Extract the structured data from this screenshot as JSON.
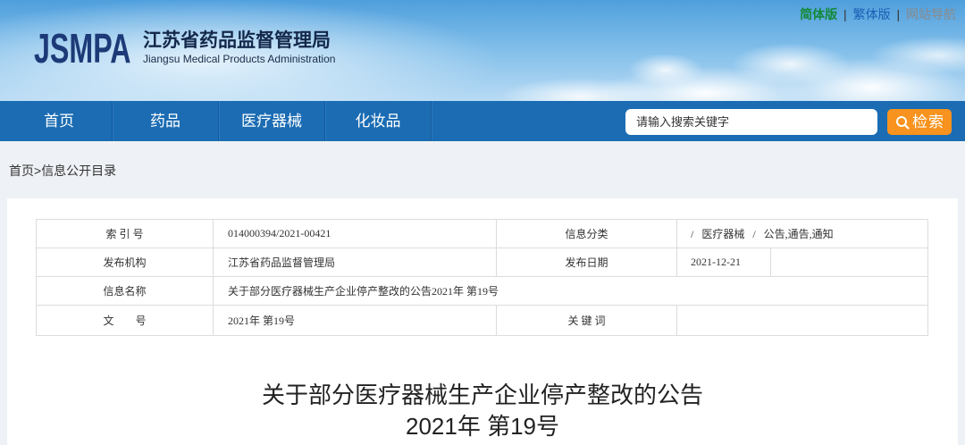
{
  "header": {
    "logo_text": "JSMPA",
    "title_cn": "江苏省药品监督管理局",
    "title_en": "Jiangsu Medical Products Administration",
    "top_links": [
      {
        "label": "简体版",
        "color": "#13893a"
      },
      {
        "label": "繁体版",
        "color": "#1a5fb4"
      },
      {
        "label": "网站导航",
        "color": "#8a8a8a"
      }
    ],
    "link_separator": "|"
  },
  "nav": {
    "items": [
      {
        "label": "首页"
      },
      {
        "label": "药品"
      },
      {
        "label": "医疗器械"
      },
      {
        "label": "化妆品"
      }
    ]
  },
  "search": {
    "placeholder": "请输入搜索关键字",
    "button_label": "检索",
    "button_icon": "search-icon"
  },
  "breadcrumb": {
    "home": "首页",
    "separator": ">",
    "current": "信息公开目录"
  },
  "info_table": {
    "index_label": "索 引 号",
    "index_value": "014000394/2021-00421",
    "category_label": "信息分类",
    "category_value": "/ 医疗器械 / 公告,通告,通知",
    "publisher_label": "发布机构",
    "publisher_value": "江苏省药品监督管理局",
    "date_label": "发布日期",
    "date_value": "2021-12-21",
    "name_label": "信息名称",
    "name_value": "关于部分医疗器械生产企业停产整改的公告2021年 第19号",
    "doc_no_label": "文　　号",
    "doc_no_value": "2021年 第19号",
    "keywords_label": "关 键 词"
  },
  "article": {
    "title": "关于部分医疗器械生产企业停产整改的公告",
    "doc_number": "2021年 第19号"
  },
  "colors": {
    "nav_background": "#1b6cb3",
    "search_button": "#f7931e",
    "logo": "#1d3a78",
    "page_background": "#eef1f5"
  }
}
